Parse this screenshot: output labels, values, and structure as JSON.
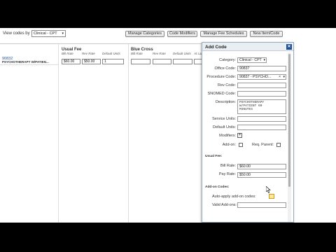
{
  "toolbar": {
    "view_label": "View codes by",
    "view_select": "Clinical - CPT",
    "buttons": {
      "manage_categories": "Manage Categories",
      "code_modifiers": "Code Modifiers",
      "manage_fee_schedules": "Manage Fee Schedules",
      "new_item_code": "New Item/Code"
    }
  },
  "grid": {
    "row": {
      "code": "90832",
      "description": "PSYCHOTHERAPY W/PATIEN..."
    },
    "groups": {
      "usual_fee": {
        "title": "Usual Fee",
        "columns": {
          "bill_rate": "Bill Rate",
          "rev_rate": "Rev Rate",
          "default_units": "Default Units"
        },
        "values": {
          "bill_rate": "$60.00",
          "rev_rate": "$50.00",
          "default_units": "1"
        }
      },
      "blue_cross": {
        "title": "Blue Cross",
        "columns": {
          "bill_rate": "Bill Rate",
          "rev_rate": "Rev Rate",
          "default_units": "Default Units",
          "at_lab": "At Lab"
        }
      }
    }
  },
  "dialog": {
    "title": "Add Code",
    "close_icon": "close-icon",
    "fields": {
      "category": {
        "label": "Category:",
        "value": "Clinical - CPT"
      },
      "office_code": {
        "label": "Office Code:",
        "value": "90837"
      },
      "procedure_code": {
        "label": "Procedure Code:",
        "value": "90837 - PSYCHO...",
        "clear": "×"
      },
      "rev_code": {
        "label": "Rev Code:",
        "value": ""
      },
      "snomed_code": {
        "label": "SNOMED Code:",
        "value": ""
      },
      "description": {
        "label": "Description:",
        "value": "PSYCHOTHERAPY\nW/PATIENT 60\nMINUTES"
      },
      "service_units": {
        "label": "Service Units:",
        "value": ""
      },
      "default_units": {
        "label": "Default Units:",
        "value": ""
      },
      "modifiers": {
        "label": "Modifiers:",
        "button": "+"
      },
      "add_on": {
        "label": "Add-on:",
        "req_parent": "Req. Parent:"
      }
    },
    "usual_fee": {
      "title": "Usual Fee:",
      "bill_rate": {
        "label": "Bill Rate:",
        "value": "$60.00"
      },
      "pay_rate": {
        "label": "Pay Rate:",
        "value": "$50.00"
      }
    },
    "add_on_codes": {
      "title": "Add-on Codes:",
      "auto_apply": "Auto-apply add-on codes:",
      "valid_add_ons": "Valid Add-ons:"
    }
  },
  "colors": {
    "link": "#2255aa",
    "close_button": "#1d4f9a",
    "highlight_checkbox": "#ffe9a8"
  }
}
